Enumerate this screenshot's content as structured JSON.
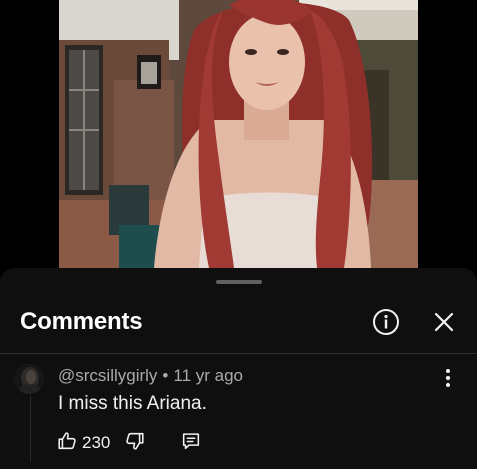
{
  "video": {
    "description_icon": "video-thumbnail"
  },
  "comments_sheet": {
    "title": "Comments",
    "info_icon": "info-icon",
    "close_icon": "close-icon"
  },
  "comment": {
    "author": "@srcsillygirly",
    "separator": "•",
    "age": "11 yr ago",
    "text": "I miss this Ariana.",
    "like_count": "230",
    "icons": [
      "thumbs-up-icon",
      "thumbs-down-icon",
      "reply-icon",
      "more-vert-icon"
    ]
  },
  "colors": {
    "background": "#000000",
    "sheet": "#0f0f0f",
    "primary_text": "#f1f1f1",
    "secondary_text": "#aaaaaa"
  }
}
